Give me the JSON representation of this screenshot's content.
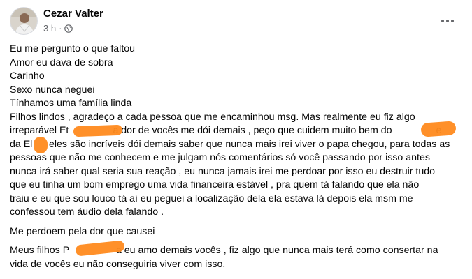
{
  "post": {
    "author": "Cezar Valter",
    "time": "3 h",
    "separator": "·",
    "privacy_icon": "globe-icon",
    "more_icon": "more-horizontal-icon",
    "lines": [
      "Eu me pergunto o que faltou",
      "Amor eu dava de sobra",
      "Carinho",
      "Sexo nunca neguei",
      "Tínhamos uma família linda",
      "Filhos lindos , agradeço a cada pessoa que me encaminhou msg. Mas realmente eu fiz algo",
      "irreparável Et                a dor de vocês me dói demais , peço que cuidem muito bem do                e",
      "da El      eles são incríveis dói demais saber que nunca mais irei viver o papa chegou, para todas as",
      "pessoas que não me conhecem e me julgam nós comentários só você passando por isso antes",
      "nunca irá saber qual seria sua reação , eu nunca jamais irei me perdoar por isso eu destruir tudo",
      "que eu tinha um bom emprego uma vida financeira estável , pra quem tá falando que ela não",
      "traiu e eu que sou louco tá aí eu peguei a localização dela ela estava lá depois ela msm me",
      "confessou tem áudio dela falando ."
    ],
    "apology": "Me perdoem pela dor que causei",
    "closing_lines": [
      "Meus filhos P                 a eu amo demais vocês , fiz algo que nunca mais terá como consertar na",
      "vida de vocês eu não conseguiria viver com isso."
    ]
  },
  "colors": {
    "text": "#050505",
    "secondary_text": "#65676b",
    "redaction": "#ff8a1e"
  }
}
